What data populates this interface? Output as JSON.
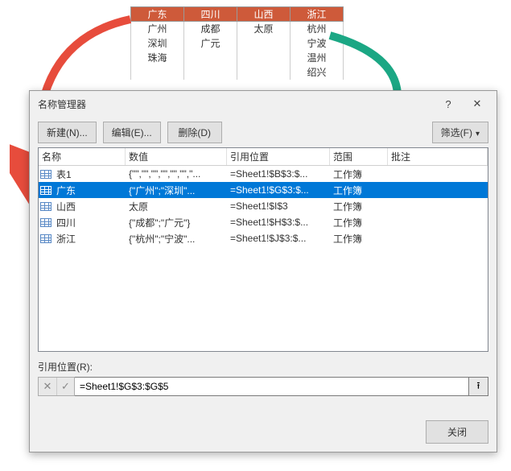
{
  "top_table": {
    "headers": [
      "广东",
      "四川",
      "山西",
      "浙江"
    ],
    "rows": [
      [
        "广州",
        "成都",
        "太原",
        "杭州"
      ],
      [
        "深圳",
        "广元",
        "",
        "宁波"
      ],
      [
        "珠海",
        "",
        "",
        "温州"
      ],
      [
        "",
        "",
        "",
        "绍兴"
      ]
    ]
  },
  "dialog": {
    "title": "名称管理器",
    "help": "?",
    "toolbar": {
      "new": "新建(N)...",
      "edit": "编辑(E)...",
      "delete": "删除(D)",
      "filter": "筛选(F)"
    },
    "columns": {
      "name": "名称",
      "value": "数值",
      "ref": "引用位置",
      "scope": "范围",
      "comment": "批注"
    },
    "rows": [
      {
        "name": "表1",
        "value": "{\"\",\"\",\"\",\"\",\"\",\"\",\"...",
        "ref": "=Sheet1!$B$3:$...",
        "scope": "工作簿",
        "comment": "",
        "selected": false
      },
      {
        "name": "广东",
        "value": "{\"广州\";\"深圳\"...",
        "ref": "=Sheet1!$G$3:$...",
        "scope": "工作簿",
        "comment": "",
        "selected": true
      },
      {
        "name": "山西",
        "value": "太原",
        "ref": "=Sheet1!$I$3",
        "scope": "工作簿",
        "comment": "",
        "selected": false
      },
      {
        "name": "四川",
        "value": "{\"成都\";\"广元\"}",
        "ref": "=Sheet1!$H$3:$...",
        "scope": "工作簿",
        "comment": "",
        "selected": false
      },
      {
        "name": "浙江",
        "value": "{\"杭州\";\"宁波\"...",
        "ref": "=Sheet1!$J$3:$...",
        "scope": "工作簿",
        "comment": "",
        "selected": false
      }
    ],
    "ref_label": "引用位置(R):",
    "ref_value": "=Sheet1!$G$3:$G$5",
    "close": "关闭"
  },
  "colors": {
    "header_bg": "#ce5a3a",
    "selection": "#0078d7",
    "arrow_red": "#e74c3c",
    "arrow_green": "#1ba784"
  }
}
